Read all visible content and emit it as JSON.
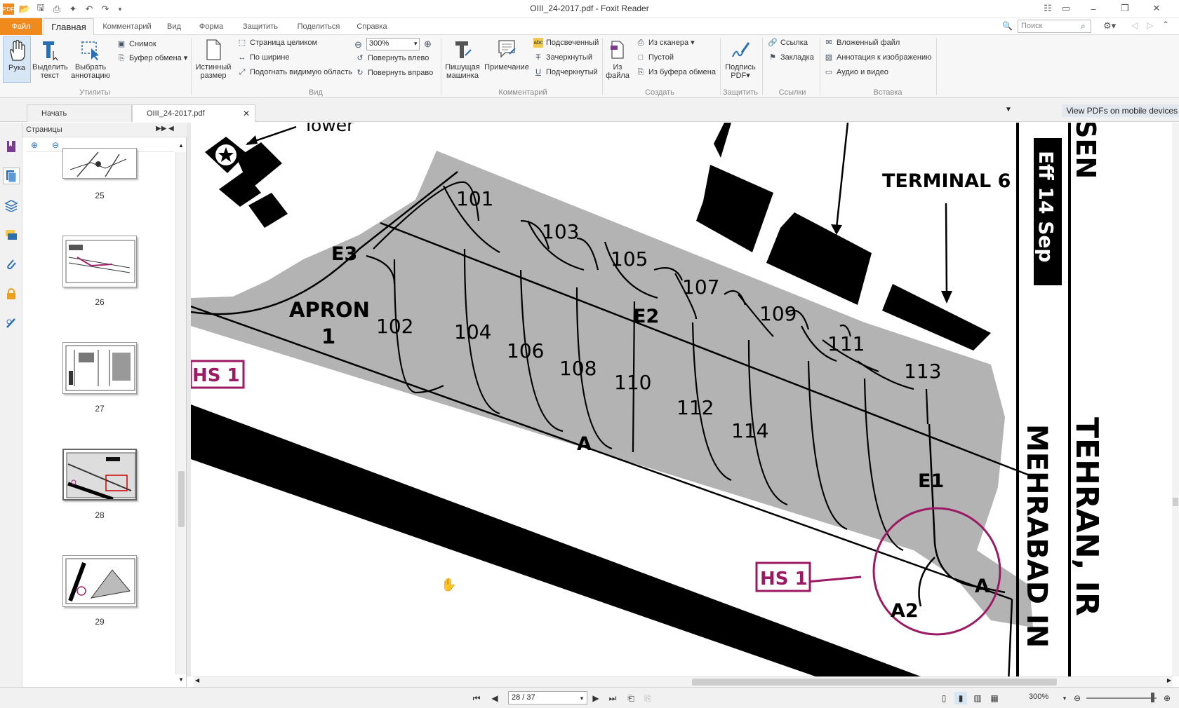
{
  "window": {
    "title": "OIII_24-2017.pdf - Foxit Reader"
  },
  "menu": {
    "file": "Файл",
    "home": "Главная",
    "tabs": [
      "Комментарий",
      "Вид",
      "Форма",
      "Защитить",
      "Поделиться",
      "Справка"
    ],
    "search_placeholder": "Поиск"
  },
  "ribbon": {
    "hand": "Рука",
    "select_text": [
      "Выделить",
      "текст"
    ],
    "select_annot": [
      "Выбрать",
      "аннотацию"
    ],
    "snapshot": "Снимок",
    "clipboard": "Буфер обмена",
    "actual_size": [
      "Истинный",
      "размер"
    ],
    "fit_page": "Страница целиком",
    "fit_width": "По ширине",
    "fit_visible": "Подогнать видимую область",
    "zoom": "300%",
    "rotate_left": "Повернуть влево",
    "rotate_right": "Повернуть вправо",
    "typewriter": [
      "Пишущая",
      "машинка"
    ],
    "note": "Примечание",
    "highlight": "Подсвеченный",
    "strikeout": "Зачеркнутый",
    "underline": "Подчеркнутый",
    "from_file": [
      "Из",
      "файла"
    ],
    "from_scanner": "Из сканера",
    "blank": "Пустой",
    "from_clipboard": "Из буфера обмена",
    "sign": [
      "Подпись",
      "PDF"
    ],
    "link": "Ссылка",
    "bookmark": "Закладка",
    "attach": "Вложенный файл",
    "image_annot": "Аннотация к изображению",
    "audio_video": "Аудио и видео",
    "groups": {
      "tools": "Утилиты",
      "view": "Вид",
      "comment": "Комментарий",
      "create": "Создать",
      "protect": "Защитить",
      "links": "Ссылки",
      "insert": "Вставка"
    }
  },
  "doc_tabs": {
    "start": "Начать",
    "file": "OIII_24-2017.pdf",
    "mobile": "View PDFs on mobile devices"
  },
  "pages_panel": {
    "title": "Страницы",
    "thumbs": [
      {
        "label": "25"
      },
      {
        "label": "26"
      },
      {
        "label": "27"
      },
      {
        "label": "28"
      },
      {
        "label": "29"
      }
    ]
  },
  "chart": {
    "tower": "Tower",
    "terminal": "TERMINAL 6",
    "apron": [
      "APRON",
      "1"
    ],
    "hs_label": "HS 1",
    "stands": [
      "101",
      "102",
      "103",
      "104",
      "105",
      "106",
      "107",
      "108",
      "109",
      "110",
      "111",
      "112",
      "113",
      "114"
    ],
    "taxi": {
      "e1": "E1",
      "e2": "E2",
      "e3": "E3",
      "a": "A",
      "a2": "A2"
    },
    "side_eff": "Eff 14 Sep",
    "side_sen": "SEN",
    "side_tehran": "TEHRAN, IR",
    "side_mehrabad": "MEHRABAD IN"
  },
  "status": {
    "page": "28 / 37",
    "zoom": "300%"
  }
}
